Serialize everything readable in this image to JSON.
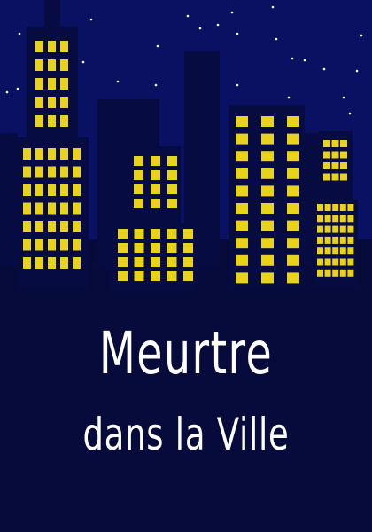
{
  "poster": {
    "title_line1": "Meurtre",
    "title_line2": "dans la Ville"
  },
  "colors": {
    "sky": "#0a1162",
    "ground": "#060b3c",
    "building": "#060b42",
    "window": "#e8d21a",
    "star": "#ffffff",
    "text": "#ffffff"
  }
}
